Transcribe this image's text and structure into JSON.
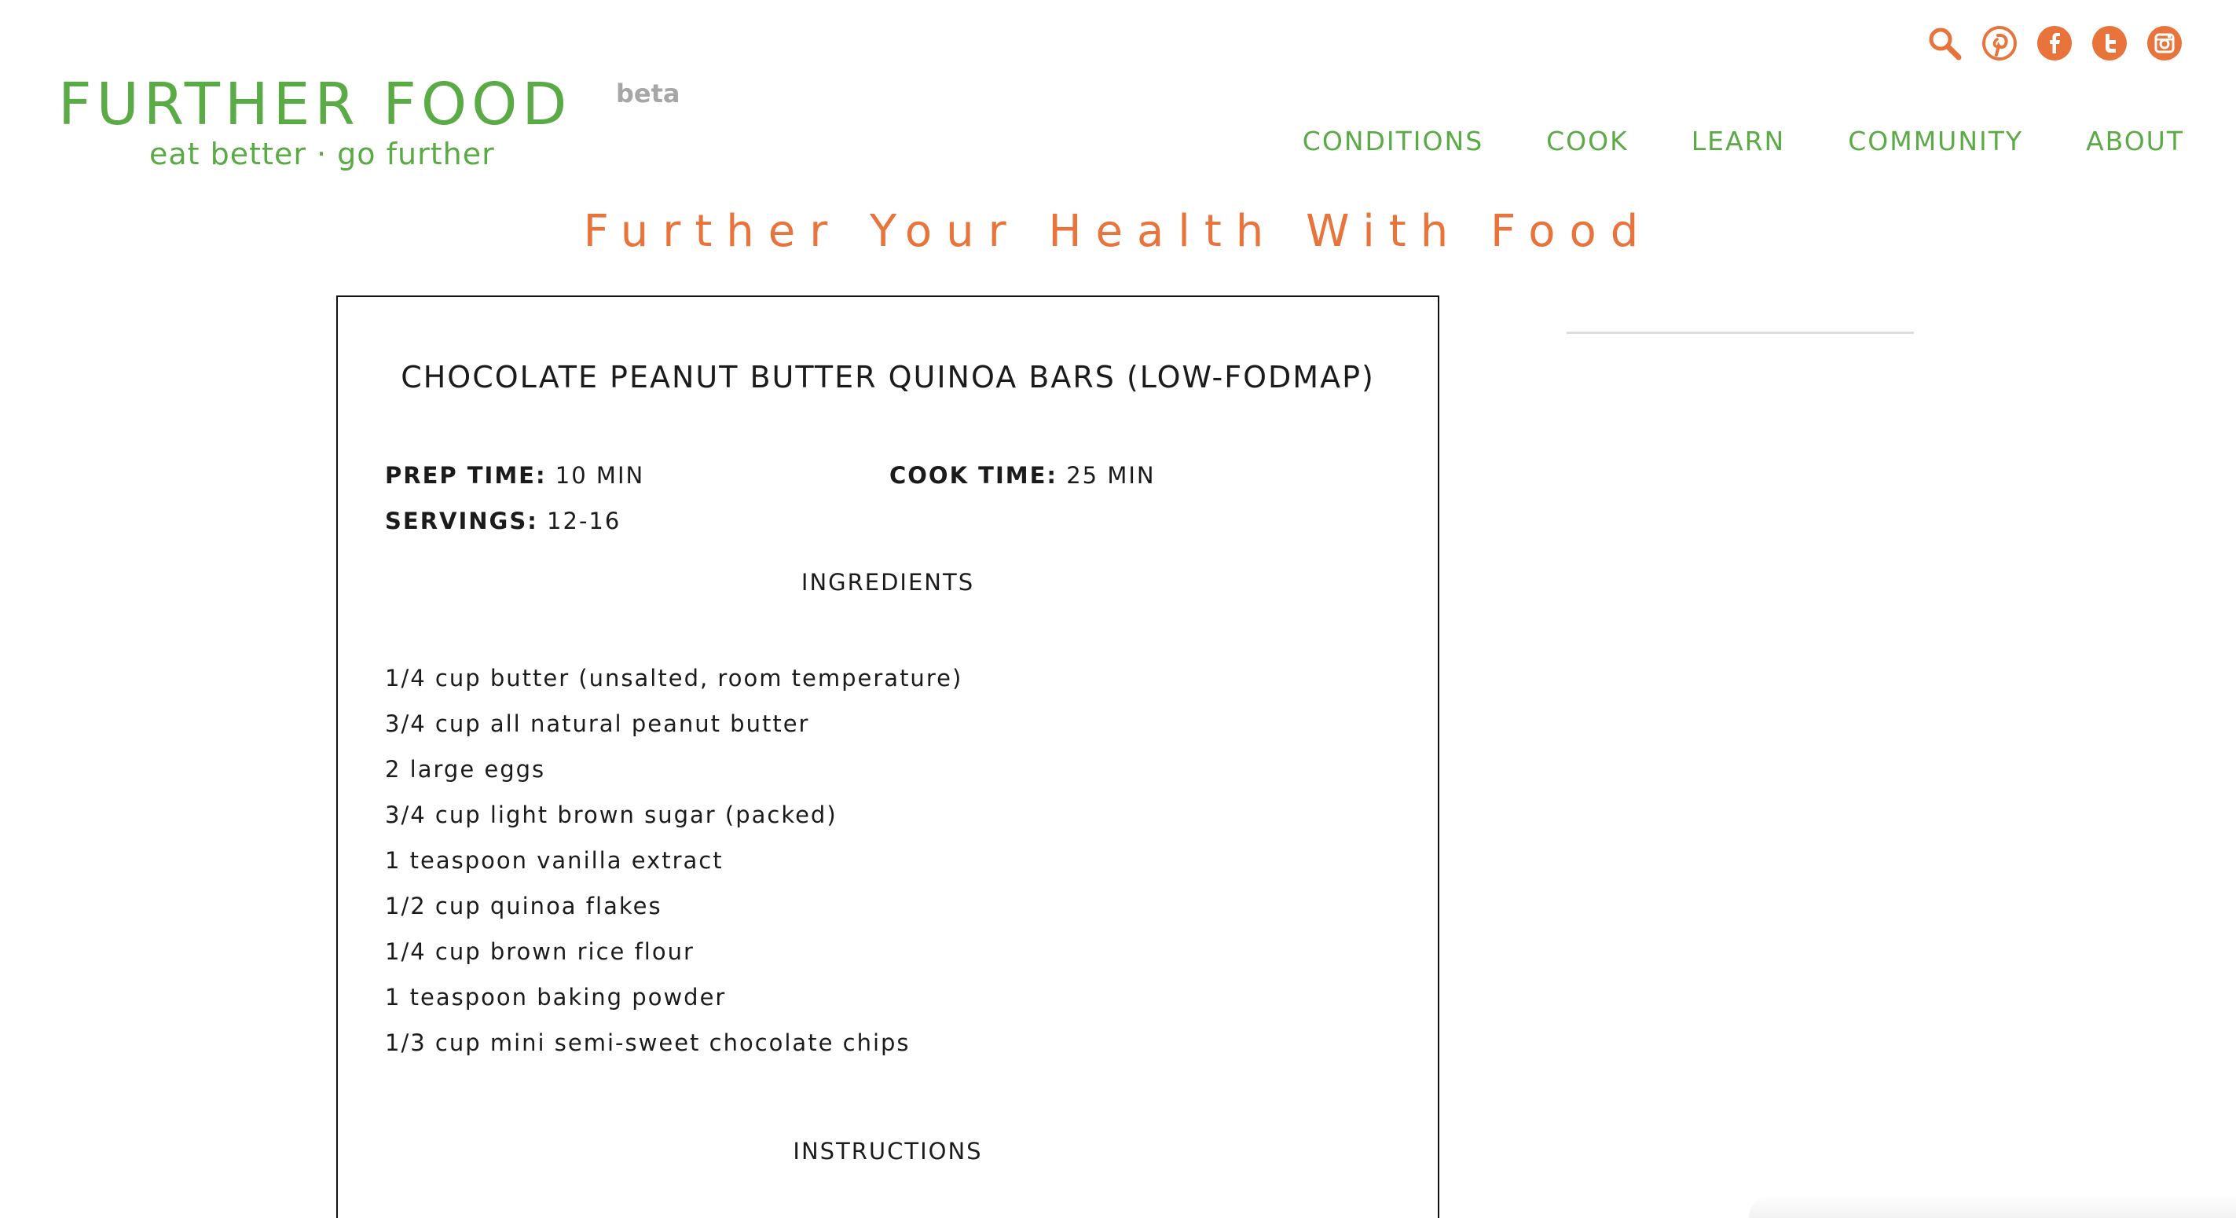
{
  "brand": {
    "name": "FURTHER FOOD",
    "badge": "beta",
    "tagline": "eat better · go further",
    "primary_color": "#5aaa46",
    "accent_color": "#e8743b"
  },
  "social": [
    {
      "icon": "search-icon"
    },
    {
      "icon": "pinterest-icon"
    },
    {
      "icon": "facebook-icon"
    },
    {
      "icon": "twitter-icon"
    },
    {
      "icon": "instagram-icon"
    }
  ],
  "nav": {
    "items": [
      "CONDITIONS",
      "COOK",
      "LEARN",
      "COMMUNITY",
      "ABOUT"
    ]
  },
  "headline": "Further Your Health With Food",
  "recipe": {
    "title": "CHOCOLATE PEANUT BUTTER QUINOA BARS (LOW-FODMAP)",
    "prep_label": "PREP TIME:",
    "prep_value": " 10 MIN",
    "cook_label": "COOK TIME:",
    "cook_value": " 25 MIN",
    "servings_label": "SERVINGS:",
    "servings_value": " 12-16",
    "ingredients_heading": "INGREDIENTS",
    "ingredients": [
      "1/4 cup butter (unsalted, room temperature)",
      "3/4 cup all natural peanut butter",
      "2 large eggs",
      "3/4 cup light brown sugar (packed)",
      "1 teaspoon vanilla extract",
      "1/2 cup quinoa flakes",
      "1/4 cup brown rice flour",
      "1 teaspoon baking powder",
      "1/3 cup mini semi-sweet chocolate chips"
    ],
    "instructions_heading": "INSTRUCTIONS"
  }
}
